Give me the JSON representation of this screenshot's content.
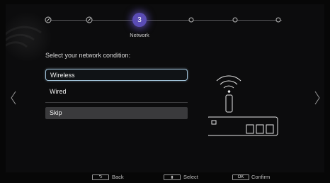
{
  "wizard": {
    "steps": [
      {
        "state": "done",
        "icon": "check-icon"
      },
      {
        "state": "done",
        "icon": "check-icon"
      },
      {
        "state": "active",
        "number": "3",
        "label": "Network"
      },
      {
        "state": "pending",
        "icon": "dot-icon"
      },
      {
        "state": "pending",
        "icon": "dot-icon"
      },
      {
        "state": "pending",
        "icon": "dot-icon"
      }
    ]
  },
  "network": {
    "prompt": "Select your network condition:",
    "options": [
      "Wireless",
      "Wired"
    ],
    "selected": "Wireless",
    "skip_label": "Skip"
  },
  "nav": {
    "prev_icon": "chevron-left-icon",
    "next_icon": "chevron-right-icon"
  },
  "illustration": {
    "icon": "wireless-router-icon"
  },
  "footer": {
    "back_key": "⮌",
    "back_label": "Back",
    "select_key": "⬍",
    "select_label": "Select",
    "confirm_key": "OK",
    "confirm_label": "Confirm"
  },
  "colors": {
    "accent": "#5a4cb5",
    "selection_border": "#9fc0d6",
    "background": "#0c0c0d",
    "skip_bg": "#3a3a3c"
  }
}
